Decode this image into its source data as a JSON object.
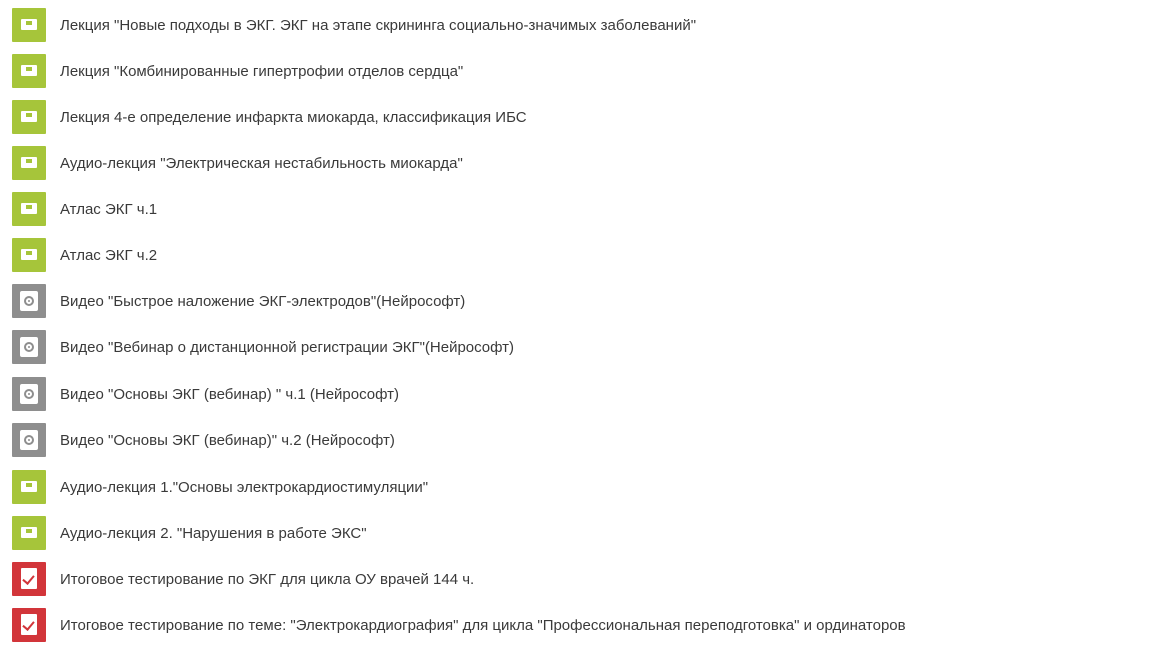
{
  "items": [
    {
      "type": "lecture",
      "icon": "lecture-page-icon",
      "title": "Лекция \"Новые подходы в ЭКГ. ЭКГ на этапе скрининга социально-значимых заболеваний\""
    },
    {
      "type": "lecture",
      "icon": "lecture-page-icon",
      "title": "Лекция \"Комбинированные гипертрофии отделов сердца\""
    },
    {
      "type": "lecture",
      "icon": "lecture-page-icon",
      "title": "Лекция 4-е определение инфаркта миокарда, классификация ИБС"
    },
    {
      "type": "lecture",
      "icon": "lecture-page-icon",
      "title": "Аудио-лекция \"Электрическая нестабильность миокарда\""
    },
    {
      "type": "lecture",
      "icon": "lecture-page-icon",
      "title": "Атлас ЭКГ ч.1"
    },
    {
      "type": "lecture",
      "icon": "lecture-page-icon",
      "title": "Атлас ЭКГ ч.2"
    },
    {
      "type": "video",
      "icon": "video-reel-icon",
      "title": "Видео \"Быстрое наложение ЭКГ-электродов\"(Нейрософт)"
    },
    {
      "type": "video",
      "icon": "video-reel-icon",
      "title": "Видео \"Вебинар о дистанционной регистрации ЭКГ\"(Нейрософт)"
    },
    {
      "type": "video",
      "icon": "video-reel-icon",
      "title": "Видео \"Основы ЭКГ (вебинар) \" ч.1 (Нейрософт)"
    },
    {
      "type": "video",
      "icon": "video-reel-icon",
      "title": "Видео \"Основы ЭКГ (вебинар)\" ч.2 (Нейрософт)"
    },
    {
      "type": "lecture",
      "icon": "lecture-page-icon",
      "title": "Аудио-лекция 1.\"Основы электрокардиостимуляции\""
    },
    {
      "type": "lecture",
      "icon": "lecture-page-icon",
      "title": "Аудио-лекция 2. \"Нарушения в работе ЭКС\""
    },
    {
      "type": "test",
      "icon": "test-check-icon",
      "title": "Итоговое тестирование по ЭКГ для цикла ОУ врачей 144 ч."
    },
    {
      "type": "test",
      "icon": "test-check-icon",
      "title": "Итоговое тестирование по теме: \"Электрокардиография\" для цикла \"Профессиональная переподготовка\" и ординаторов"
    }
  ],
  "colors": {
    "lecture": "#a6c53a",
    "video": "#8e8e8e",
    "test": "#d2353a",
    "text": "#3a3a3a"
  }
}
